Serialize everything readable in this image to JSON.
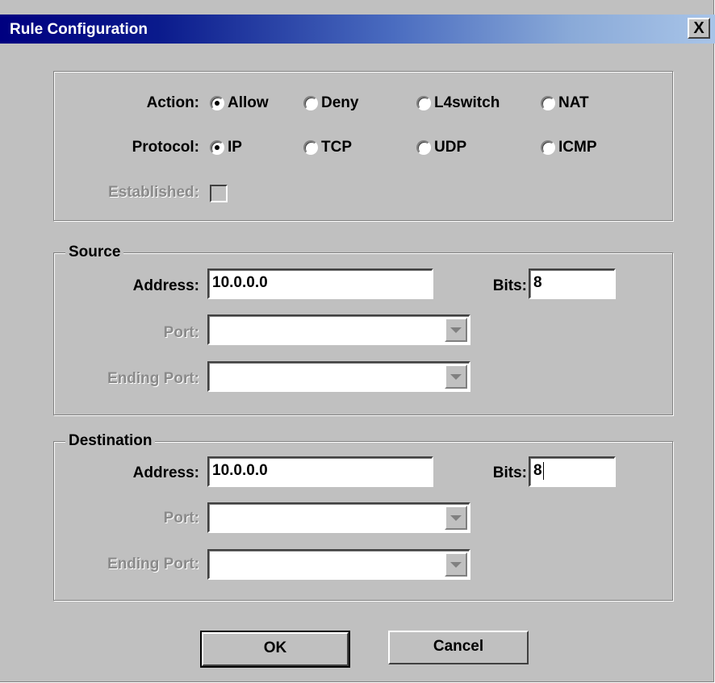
{
  "window": {
    "title": "Rule Configuration",
    "close_label": "X"
  },
  "rule": {
    "action": {
      "label": "Action:",
      "options": [
        "Allow",
        "Deny",
        "L4switch",
        "NAT"
      ],
      "selected": "Allow"
    },
    "protocol": {
      "label": "Protocol:",
      "options": [
        "IP",
        "TCP",
        "UDP",
        "ICMP"
      ],
      "selected": "IP"
    },
    "established": {
      "label": "Established:",
      "checked": false,
      "enabled": false
    }
  },
  "source": {
    "legend": "Source",
    "address_label": "Address:",
    "address_value": "10.0.0.0",
    "bits_label": "Bits:",
    "bits_value": "8",
    "port_label": "Port:",
    "port_value": "",
    "ending_port_label": "Ending Port:",
    "ending_port_value": ""
  },
  "destination": {
    "legend": "Destination",
    "address_label": "Address:",
    "address_value": "10.0.0.0",
    "bits_label": "Bits:",
    "bits_value": "8",
    "port_label": "Port:",
    "port_value": "",
    "ending_port_label": "Ending Port:",
    "ending_port_value": ""
  },
  "buttons": {
    "ok_label": "OK",
    "cancel_label": "Cancel"
  }
}
